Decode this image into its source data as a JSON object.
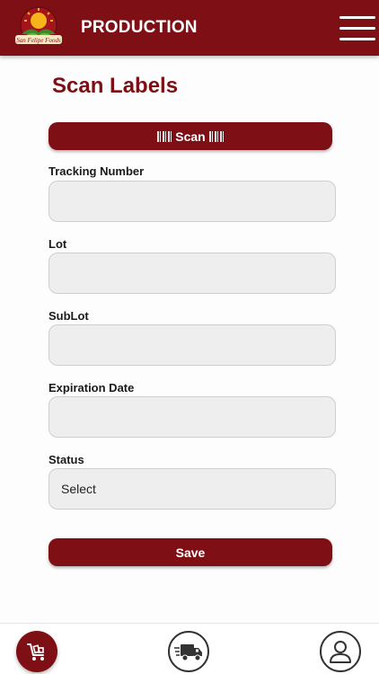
{
  "header": {
    "brand": "San Felipe Foods",
    "title": "PRODUCTION"
  },
  "main": {
    "title": "Scan Labels",
    "scan_label": "Scan",
    "fields": [
      {
        "label": "Tracking Number",
        "value": ""
      },
      {
        "label": "Lot",
        "value": ""
      },
      {
        "label": "SubLot",
        "value": ""
      },
      {
        "label": "Expiration Date",
        "value": ""
      }
    ],
    "status": {
      "label": "Status",
      "selected": "Select"
    },
    "save_label": "Save"
  },
  "bottom_nav": {
    "items": [
      {
        "icon": "cart-icon"
      },
      {
        "icon": "delivery-truck-icon"
      },
      {
        "icon": "user-icon"
      }
    ]
  },
  "colors": {
    "brand": "#7e0f14",
    "field_bg": "#eeeeee"
  }
}
